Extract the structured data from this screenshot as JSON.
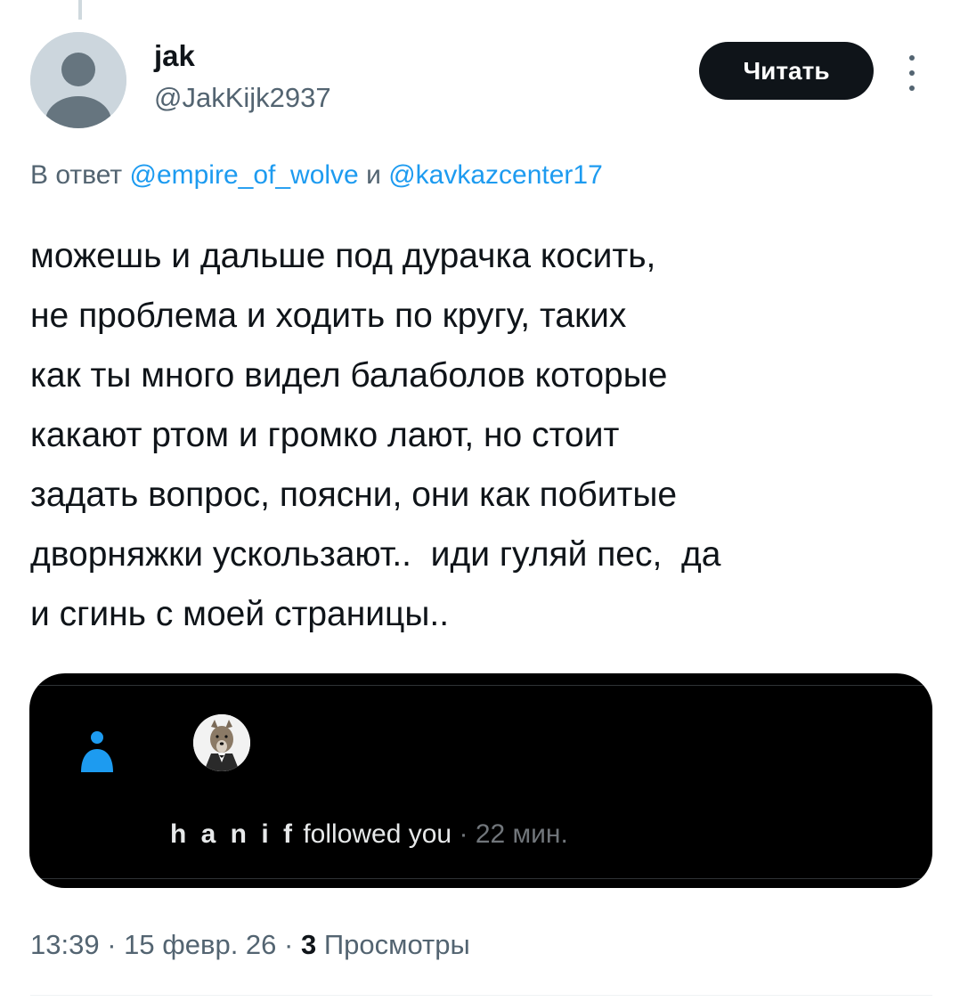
{
  "author": {
    "display_name": "jak",
    "handle": "@JakKijk2937"
  },
  "follow_button": {
    "label": "Читать"
  },
  "more_icon": "more-vertical-icon",
  "reply_context": {
    "prefix": "В ответ",
    "mention_1": "@empire_of_wolve",
    "conjunction": "и",
    "mention_2": "@kavkazcenter17"
  },
  "tweet": {
    "lines": [
      "можешь и дальше под дурачка косить,",
      "не проблема и ходить по кругу, таких",
      "как ты много видел балаболов которые",
      "какают ртом и громко лают, но стоит",
      "задать вопрос, поясни, они как побитые",
      "дворняжки ускользают..  иди гуляй пес,  да",
      "и сгинь с моей страницы.."
    ]
  },
  "attached_screenshot": {
    "icon": "person-icon",
    "avatar": "wolf-avatar",
    "user": "h a n i f",
    "action": "followed you",
    "separator": "·",
    "time": "22 мин."
  },
  "meta": {
    "time": "13:39",
    "sep1": "·",
    "date": "15 февр. 26",
    "sep2": "·",
    "views_count": "3",
    "views_label": "Просмотры"
  },
  "colors": {
    "accent": "#1d9bf0",
    "text": "#0f1419",
    "secondary": "#536471",
    "button_bg": "#0f1419",
    "media_bg": "#000000"
  }
}
